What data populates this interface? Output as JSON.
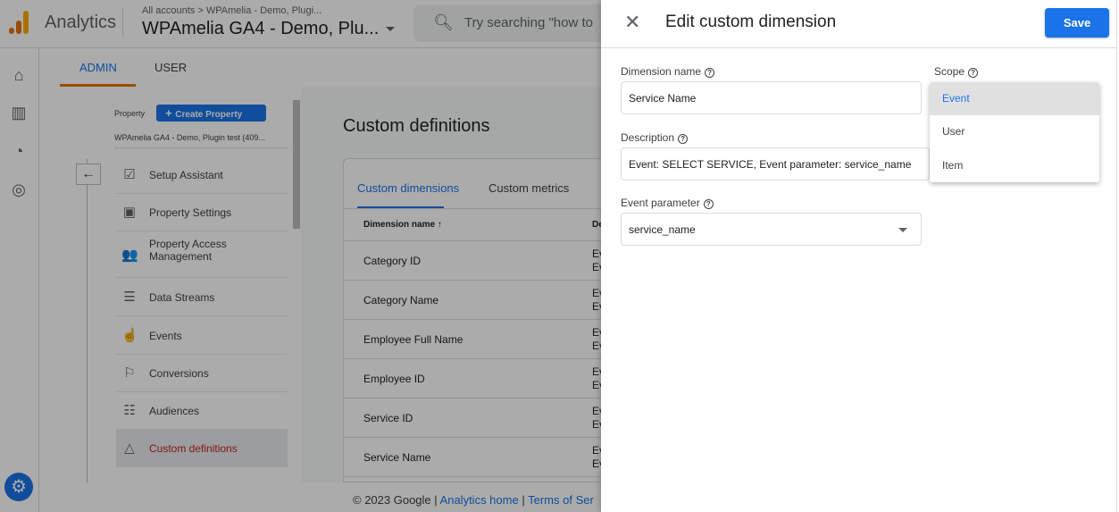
{
  "header": {
    "app_title": "Analytics",
    "breadcrumb": "All accounts > WPAmelia - Demo, Plugi...",
    "property": "WPAmelia GA4 - Demo, Plu...",
    "search_placeholder": "Try searching \"how to"
  },
  "rail": {
    "icons": [
      "home-icon",
      "reports-icon",
      "explore-icon",
      "advertising-icon"
    ],
    "settings_icon": "gear-icon"
  },
  "tabs": [
    {
      "label": "ADMIN",
      "active": true
    },
    {
      "label": "USER",
      "active": false
    }
  ],
  "nav": {
    "property_label": "Property",
    "create_property": "Create Property",
    "property_name": "WPAmelia GA4 - Demo, Plugin test (409...",
    "items": [
      {
        "label": "Setup Assistant",
        "icon": "☑"
      },
      {
        "label": "Property Settings",
        "icon": "▣"
      },
      {
        "label": "Property Access Management",
        "icon": "👥"
      },
      {
        "label": "Data Streams",
        "icon": "☰"
      },
      {
        "label": "Events",
        "icon": "☝"
      },
      {
        "label": "Conversions",
        "icon": "⚐"
      },
      {
        "label": "Audiences",
        "icon": "☷"
      },
      {
        "label": "Custom definitions",
        "icon": "△",
        "selected": true
      }
    ]
  },
  "main": {
    "title": "Custom definitions",
    "tabs": [
      "Custom dimensions",
      "Custom metrics"
    ],
    "columns": [
      "Dimension name ↑",
      "De"
    ],
    "rows": [
      "Category ID",
      "Category Name",
      "Employee Full Name",
      "Employee ID",
      "Service ID",
      "Service Name"
    ],
    "row_desc": [
      "Ev",
      "Ev"
    ]
  },
  "footer": {
    "copyright": "© 2023 Google |",
    "home": "Analytics home",
    "sep": "|",
    "terms": "Terms of Ser"
  },
  "drawer": {
    "title": "Edit custom dimension",
    "save": "Save",
    "dimension_name_label": "Dimension name",
    "dimension_name_value": "Service Name",
    "description_label": "Description",
    "description_value": "Event: SELECT SERVICE, Event parameter: service_name",
    "event_parameter_label": "Event parameter",
    "event_parameter_value": "service_name",
    "scope_label": "Scope",
    "scope_options": [
      "Event",
      "User",
      "Item"
    ],
    "scope_selected": "Event"
  },
  "colors": {
    "accent": "#1a73e8",
    "selected_nav": "#c5221f",
    "tab_underline": "#e37400"
  }
}
